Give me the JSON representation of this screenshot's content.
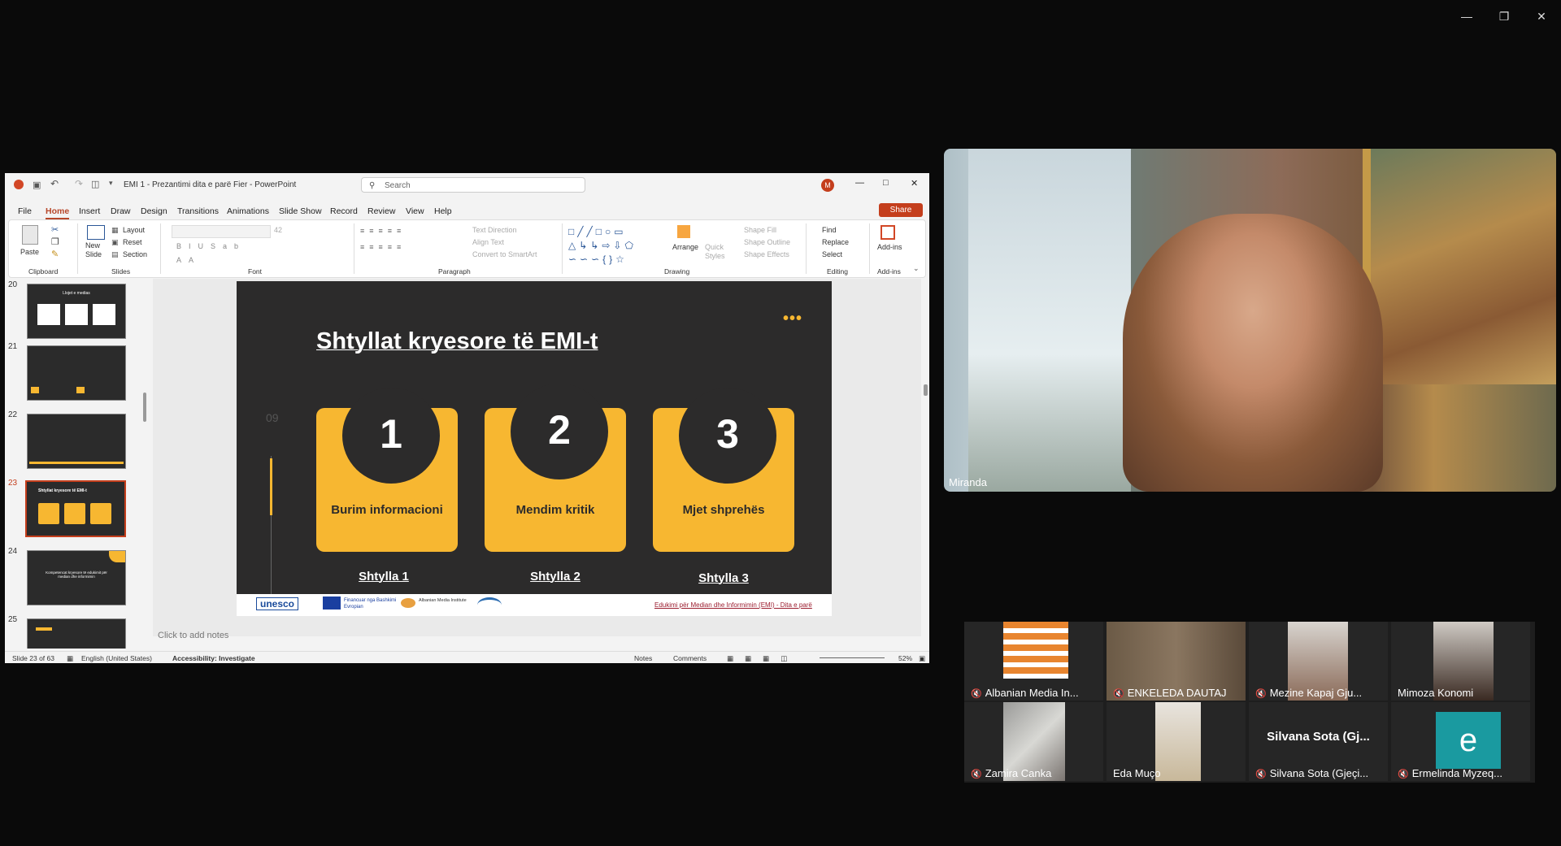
{
  "ppt": {
    "title": "EMI 1 - Prezantimi dita e parë Fier  -  PowerPoint",
    "search_placeholder": "Search",
    "avatar_initial": "M",
    "share_label": "Share",
    "menu": [
      "File",
      "Home",
      "Insert",
      "Draw",
      "Design",
      "Transitions",
      "Animations",
      "Slide Show",
      "Record",
      "Review",
      "View",
      "Help"
    ],
    "ribbon": {
      "paste": "Paste",
      "clipboard": "Clipboard",
      "new_slide": "New\nSlide",
      "layout": "Layout",
      "reset": "Reset",
      "section": "Section",
      "slides": "Slides",
      "font_size": "42",
      "font": "Font",
      "paragraph": "Paragraph",
      "text_direction": "Text Direction",
      "align_text": "Align Text",
      "convert_smartart": "Convert to SmartArt",
      "arrange": "Arrange",
      "quick_styles": "Quick\nStyles",
      "shape_fill": "Shape Fill",
      "shape_outline": "Shape Outline",
      "shape_effects": "Shape Effects",
      "drawing": "Drawing",
      "find": "Find",
      "replace": "Replace",
      "select": "Select",
      "editing": "Editing",
      "addins": "Add-ins",
      "addins_group": "Add-ins"
    },
    "thumbs": [
      {
        "num": "20",
        "title": "Llojet e medias"
      },
      {
        "num": "21",
        "title": ""
      },
      {
        "num": "22",
        "title": ""
      },
      {
        "num": "23",
        "title": "Shtyllat kryesore të EMI-t"
      },
      {
        "num": "24",
        "title": "Kompetencat kryesore të edukimit për median dhe informimin"
      },
      {
        "num": "25",
        "title": ""
      }
    ],
    "slide": {
      "title": "Shtyllat kryesore të EMI-t",
      "number": "09",
      "cards": [
        {
          "num": "1",
          "label": "Burim informacioni",
          "pillar": "Shtylla 1"
        },
        {
          "num": "2",
          "label": "Mendim kritik",
          "pillar": "Shtylla 2"
        },
        {
          "num": "3",
          "label": "Mjet shprehës",
          "pillar": "Shtylla 3"
        }
      ],
      "footer_logos": [
        "unesco",
        "Financuar nga Bashkimi Evropian",
        "Albanian Media Institute"
      ],
      "footer_text": "Edukimi për Median dhe Informimin (EMI) - Dita e parë"
    },
    "notes_placeholder": "Click to add notes",
    "status": {
      "slide_count": "Slide 23 of 63",
      "language": "English (United States)",
      "accessibility": "Accessibility: Investigate",
      "notes": "Notes",
      "comments": "Comments",
      "zoom": "52%"
    }
  },
  "meeting": {
    "speaker": "Miranda",
    "participants": [
      {
        "name": "Albanian Media In...",
        "muted": true
      },
      {
        "name": "ENKELEDA DAUTAJ",
        "muted": true
      },
      {
        "name": "Mezine Kapaj Gju...",
        "muted": true
      },
      {
        "name": "Mimoza Konomi",
        "muted": false
      },
      {
        "name": "Zamira Canka",
        "muted": true
      },
      {
        "name": "Eda Muço",
        "muted": false
      },
      {
        "name": "Silvana Sota (Gjeçi...",
        "muted": true,
        "display": "Silvana Sota (Gj..."
      },
      {
        "name": "Ermelinda Myzeq...",
        "muted": true,
        "initial": "e"
      }
    ]
  },
  "colors": {
    "accent": "#f7b731",
    "slide_bg": "#2c2b2b",
    "ppt_red": "#c43e1c"
  }
}
